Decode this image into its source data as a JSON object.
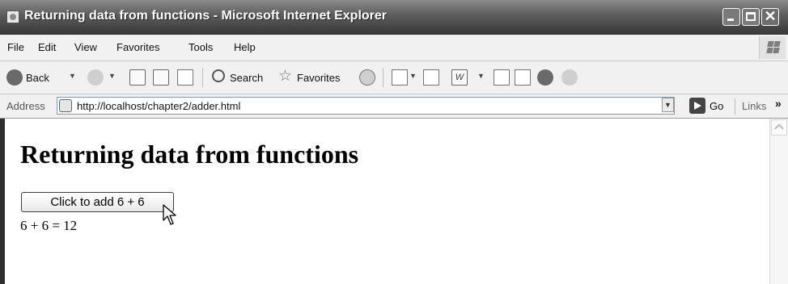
{
  "window": {
    "title": "Returning data from functions - Microsoft Internet Explorer"
  },
  "menubar": {
    "items": [
      "File",
      "Edit",
      "View",
      "Favorites",
      "Tools",
      "Help"
    ]
  },
  "toolbar": {
    "back_label": "Back",
    "search_label": "Search",
    "favorites_label": "Favorites"
  },
  "addressbar": {
    "label": "Address",
    "url": "http://localhost/chapter2/adder.html",
    "go_label": "Go",
    "links_label": "Links"
  },
  "page": {
    "heading": "Returning data from functions",
    "button_label": "Click to add 6 + 6",
    "result_text": "6 + 6 = 12"
  },
  "icons": [
    "ie-page-icon",
    "minimize-icon",
    "maximize-icon",
    "close-icon",
    "windows-flag-icon",
    "back-arrow-icon",
    "forward-arrow-icon",
    "stop-icon",
    "refresh-icon",
    "home-icon",
    "search-icon",
    "favorites-star-icon",
    "history-icon",
    "mail-icon",
    "print-icon",
    "edit-word-icon",
    "discuss-icon",
    "research-icon",
    "messenger-icon",
    "go-arrow-icon",
    "mouse-pointer-icon"
  ]
}
